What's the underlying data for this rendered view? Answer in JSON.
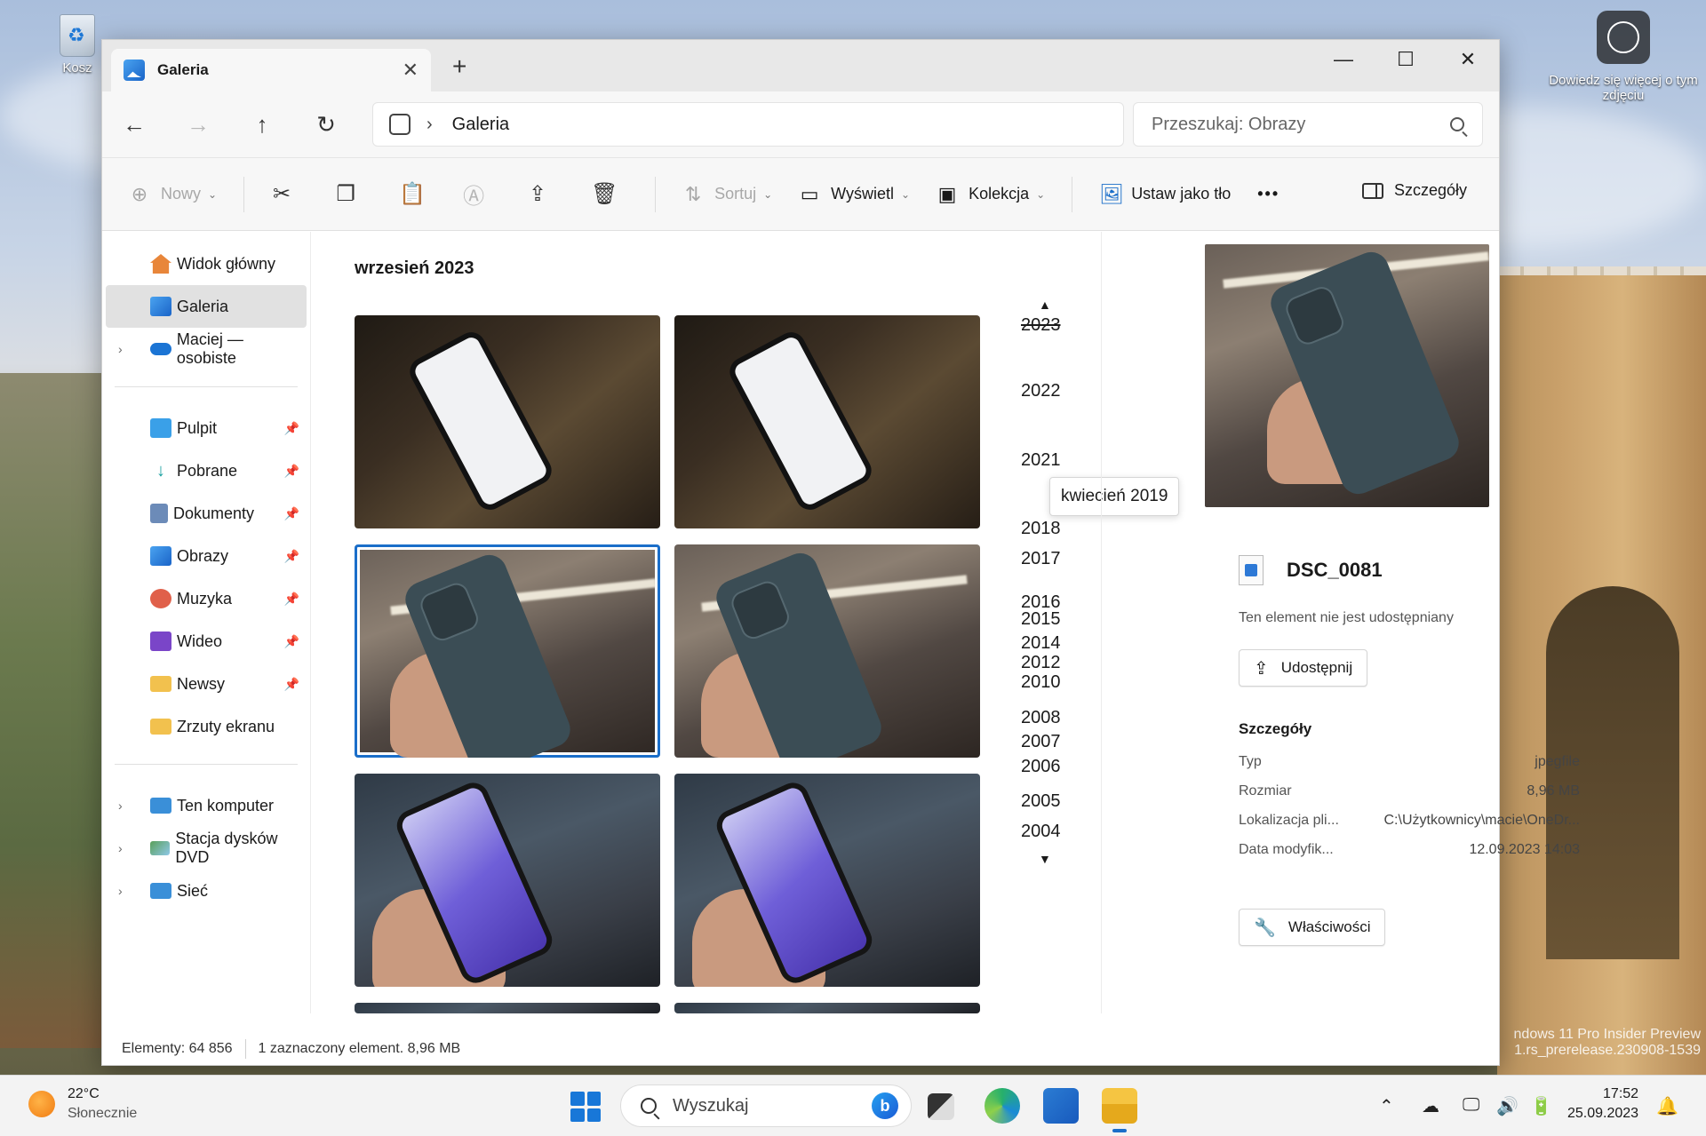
{
  "desktop": {
    "recycle_bin_label": "Kosz",
    "learn_more_label": "Dowiedz się więcej o tym zdjęciu",
    "watermark_line1": "ndows 11 Pro Insider Preview",
    "watermark_line2": "1.rs_prerelease.230908-1539"
  },
  "window": {
    "tab_title": "Galeria",
    "new_tab": "+",
    "minimize": "—",
    "maximize": "☐",
    "close": "✕"
  },
  "nav": {
    "back": "←",
    "forward": "→",
    "up": "↑",
    "refresh": "↻",
    "breadcrumb": "Galeria",
    "search_placeholder": "Przeszukaj: Obrazy"
  },
  "toolbar": {
    "new_label": "Nowy",
    "sort_label": "Sortuj",
    "view_label": "Wyświetl",
    "collection_label": "Kolekcja",
    "set_bg_label": "Ustaw jako tło",
    "more_label": "•••",
    "details_label": "Szczegóły"
  },
  "sidebar": {
    "top": [
      {
        "label": "Widok główny",
        "icon": "home-icon",
        "color": "#e8863a"
      },
      {
        "label": "Galeria",
        "icon": "gallery-icon",
        "color": "#2b8ae6",
        "selected": true
      },
      {
        "label": "Maciej — osobiste",
        "icon": "cloud-icon",
        "color": "#1b74d4",
        "expandable": true
      }
    ],
    "pinned": [
      {
        "label": "Pulpit",
        "icon": "desktop-icon",
        "color": "#3aa0e8"
      },
      {
        "label": "Pobrane",
        "icon": "download-icon",
        "color": "#1aa0a0"
      },
      {
        "label": "Dokumenty",
        "icon": "documents-icon",
        "color": "#6c8bb8"
      },
      {
        "label": "Obrazy",
        "icon": "pictures-icon",
        "color": "#2a7fd8"
      },
      {
        "label": "Muzyka",
        "icon": "music-icon",
        "color": "#e0604a"
      },
      {
        "label": "Wideo",
        "icon": "video-icon",
        "color": "#7a45c8"
      },
      {
        "label": "Newsy",
        "icon": "folder-icon",
        "color": "#f2c14e"
      },
      {
        "label": "Zrzuty ekranu",
        "icon": "folder-icon",
        "color": "#f2c14e",
        "pinned": false
      }
    ],
    "devices": [
      {
        "label": "Ten komputer",
        "icon": "computer-icon",
        "color": "#3a8fd8"
      },
      {
        "label": "Stacja dysków DVD",
        "icon": "dvd-icon",
        "color": "#5aa05a"
      },
      {
        "label": "Sieć",
        "icon": "network-icon",
        "color": "#3a8fd8"
      }
    ]
  },
  "gallery": {
    "month_heading": "wrzesień 2023",
    "years": [
      "2023",
      "2022",
      "2021",
      "2018",
      "2017",
      "2016",
      "2015",
      "2014",
      "2012",
      "2010",
      "2008",
      "2007",
      "2006",
      "2005",
      "2004"
    ],
    "tooltip": "kwiecień 2019"
  },
  "details": {
    "filename": "DSC_0081",
    "sharing_status": "Ten element nie jest udostępniany",
    "share_button": "Udostępnij",
    "section_title": "Szczegóły",
    "rows": [
      {
        "key": "Typ",
        "value": "jpegfile"
      },
      {
        "key": "Rozmiar",
        "value": "8,96 MB"
      },
      {
        "key": "Lokalizacja pli...",
        "value": "C:\\Użytkownicy\\macie\\OneDr..."
      },
      {
        "key": "Data modyfik...",
        "value": "12.09.2023 14:03"
      }
    ],
    "properties_button": "Właściwości"
  },
  "status": {
    "items_count": "Elementy: 64 856",
    "selection": "1 zaznaczony element. 8,96 MB"
  },
  "taskbar": {
    "temperature": "22°C",
    "weather": "Słonecznie",
    "search_placeholder": "Wyszukaj",
    "time": "17:52",
    "date": "25.09.2023"
  }
}
